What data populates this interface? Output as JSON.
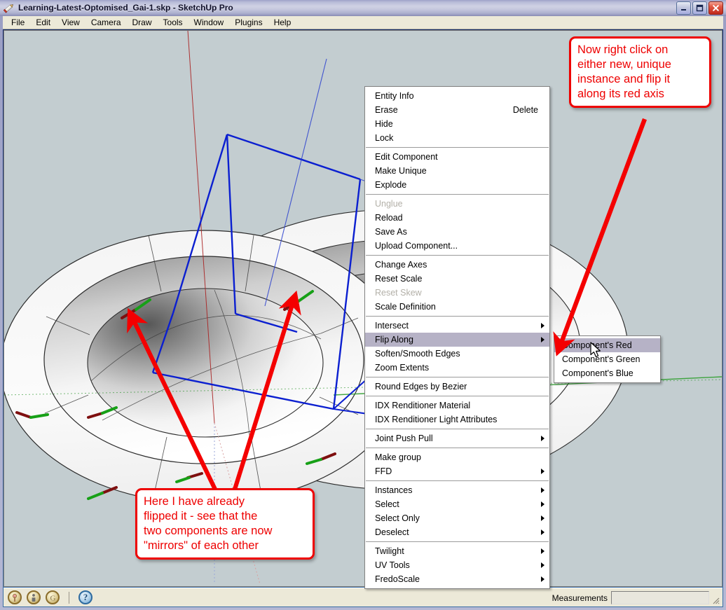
{
  "window": {
    "title": "Learning-Latest-Optomised_Gai-1.skp - SketchUp Pro",
    "app_icon": "pencil-icon",
    "controls": {
      "minimize": "minimize-icon",
      "maximize": "maximize-icon",
      "close": "close-icon"
    }
  },
  "menubar": {
    "items": [
      {
        "label": "File"
      },
      {
        "label": "Edit"
      },
      {
        "label": "View"
      },
      {
        "label": "Camera"
      },
      {
        "label": "Draw"
      },
      {
        "label": "Tools"
      },
      {
        "label": "Window"
      },
      {
        "label": "Plugins"
      },
      {
        "label": "Help"
      }
    ]
  },
  "context_menu": {
    "groups": [
      {
        "items": [
          {
            "label": "Entity Info",
            "accel": "",
            "disabled": false,
            "submenu": false,
            "highlight": false
          },
          {
            "label": "Erase",
            "accel": "Delete",
            "disabled": false,
            "submenu": false,
            "highlight": false
          },
          {
            "label": "Hide",
            "accel": "",
            "disabled": false,
            "submenu": false,
            "highlight": false
          },
          {
            "label": "Lock",
            "accel": "",
            "disabled": false,
            "submenu": false,
            "highlight": false
          }
        ]
      },
      {
        "items": [
          {
            "label": "Edit Component",
            "accel": "",
            "disabled": false,
            "submenu": false,
            "highlight": false
          },
          {
            "label": "Make Unique",
            "accel": "",
            "disabled": false,
            "submenu": false,
            "highlight": false
          },
          {
            "label": "Explode",
            "accel": "",
            "disabled": false,
            "submenu": false,
            "highlight": false
          }
        ]
      },
      {
        "items": [
          {
            "label": "Unglue",
            "accel": "",
            "disabled": true,
            "submenu": false,
            "highlight": false
          },
          {
            "label": "Reload",
            "accel": "",
            "disabled": false,
            "submenu": false,
            "highlight": false
          },
          {
            "label": "Save As",
            "accel": "",
            "disabled": false,
            "submenu": false,
            "highlight": false
          },
          {
            "label": "Upload Component...",
            "accel": "",
            "disabled": false,
            "submenu": false,
            "highlight": false
          }
        ]
      },
      {
        "items": [
          {
            "label": "Change Axes",
            "accel": "",
            "disabled": false,
            "submenu": false,
            "highlight": false
          },
          {
            "label": "Reset Scale",
            "accel": "",
            "disabled": false,
            "submenu": false,
            "highlight": false
          },
          {
            "label": "Reset Skew",
            "accel": "",
            "disabled": true,
            "submenu": false,
            "highlight": false
          },
          {
            "label": "Scale Definition",
            "accel": "",
            "disabled": false,
            "submenu": false,
            "highlight": false
          }
        ]
      },
      {
        "items": [
          {
            "label": "Intersect",
            "accel": "",
            "disabled": false,
            "submenu": true,
            "highlight": false
          },
          {
            "label": "Flip Along",
            "accel": "",
            "disabled": false,
            "submenu": true,
            "highlight": true
          },
          {
            "label": "Soften/Smooth Edges",
            "accel": "",
            "disabled": false,
            "submenu": false,
            "highlight": false
          },
          {
            "label": "Zoom Extents",
            "accel": "",
            "disabled": false,
            "submenu": false,
            "highlight": false
          }
        ]
      },
      {
        "items": [
          {
            "label": "Round Edges by Bezier",
            "accel": "",
            "disabled": false,
            "submenu": false,
            "highlight": false
          }
        ]
      },
      {
        "items": [
          {
            "label": "IDX Renditioner Material",
            "accel": "",
            "disabled": false,
            "submenu": false,
            "highlight": false
          },
          {
            "label": "IDX Renditioner Light Attributes",
            "accel": "",
            "disabled": false,
            "submenu": false,
            "highlight": false
          }
        ]
      },
      {
        "items": [
          {
            "label": "Joint Push Pull",
            "accel": "",
            "disabled": false,
            "submenu": true,
            "highlight": false
          }
        ]
      },
      {
        "items": [
          {
            "label": "Make group",
            "accel": "",
            "disabled": false,
            "submenu": false,
            "highlight": false
          },
          {
            "label": "FFD",
            "accel": "",
            "disabled": false,
            "submenu": true,
            "highlight": false
          }
        ]
      },
      {
        "items": [
          {
            "label": "Instances",
            "accel": "",
            "disabled": false,
            "submenu": true,
            "highlight": false
          },
          {
            "label": "Select",
            "accel": "",
            "disabled": false,
            "submenu": true,
            "highlight": false
          },
          {
            "label": "Select Only",
            "accel": "",
            "disabled": false,
            "submenu": true,
            "highlight": false
          },
          {
            "label": "Deselect",
            "accel": "",
            "disabled": false,
            "submenu": true,
            "highlight": false
          }
        ]
      },
      {
        "items": [
          {
            "label": "Twilight",
            "accel": "",
            "disabled": false,
            "submenu": true,
            "highlight": false
          },
          {
            "label": "UV Tools",
            "accel": "",
            "disabled": false,
            "submenu": true,
            "highlight": false
          },
          {
            "label": "FredoScale",
            "accel": "",
            "disabled": false,
            "submenu": true,
            "highlight": false
          }
        ]
      }
    ]
  },
  "submenu": {
    "parent": "Flip Along",
    "items": [
      {
        "label": "Component's Red",
        "highlight": true
      },
      {
        "label": "Component's Green",
        "highlight": false
      },
      {
        "label": "Component's Blue",
        "highlight": false
      }
    ]
  },
  "annotations": {
    "top_callout": {
      "lines": [
        "Now right click on",
        "either new, unique",
        "instance and flip it",
        "along its red axis"
      ],
      "color": "#ee0000"
    },
    "bottom_callout": {
      "lines": [
        "Here I have already",
        "flipped it - see that the",
        "two components are now",
        "\"mirrors\" of each other"
      ],
      "color": "#ee0000"
    }
  },
  "statusbar": {
    "icons": [
      {
        "name": "location-pin-icon"
      },
      {
        "name": "person-icon"
      },
      {
        "name": "google-g-icon"
      }
    ],
    "help_glyph": "?",
    "measurements_label": "Measurements",
    "measurements_value": "",
    "measurements_placeholder": ""
  },
  "viewport": {
    "background_color": "#c3cdd0",
    "model_description": "torus ring component with two selected instances",
    "selection_color": "#0000dd",
    "axis_red": "#aa0000",
    "axis_green": "#009900",
    "axis_blue": "#0000aa"
  }
}
